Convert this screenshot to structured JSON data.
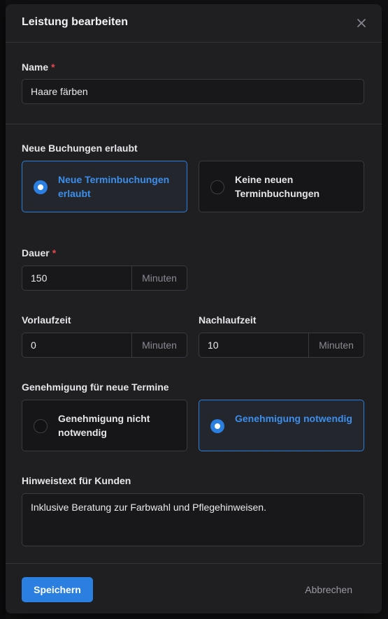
{
  "modal": {
    "title": "Leistung bearbeiten",
    "close_icon": "close-icon"
  },
  "name_field": {
    "label": "Name",
    "required_mark": "*",
    "value": "Haare färben"
  },
  "bookings": {
    "label": "Neue Buchungen erlaubt",
    "options": [
      {
        "label": "Neue Terminbuchungen erlaubt",
        "selected": true
      },
      {
        "label": "Keine neuen Terminbuchungen",
        "selected": false
      }
    ]
  },
  "duration": {
    "label": "Dauer",
    "required_mark": "*",
    "value": "150",
    "unit": "Minuten"
  },
  "lead_time": {
    "label": "Vorlaufzeit",
    "value": "0",
    "unit": "Minuten"
  },
  "follow_time": {
    "label": "Nachlaufzeit",
    "value": "10",
    "unit": "Minuten"
  },
  "approval": {
    "label": "Genehmigung für neue Termine",
    "options": [
      {
        "label": "Genehmigung nicht notwendig",
        "selected": false
      },
      {
        "label": "Genehmigung notwendig",
        "selected": true
      }
    ]
  },
  "customer_note": {
    "label": "Hinweistext für Kunden",
    "value": "Inklusive Beratung zur Farbwahl und Pflegehinweisen."
  },
  "footer": {
    "save_label": "Speichern",
    "cancel_label": "Abbrechen"
  },
  "colors": {
    "accent": "#2b7fe0",
    "required": "#e5484d",
    "surface": "#1f1f22"
  }
}
